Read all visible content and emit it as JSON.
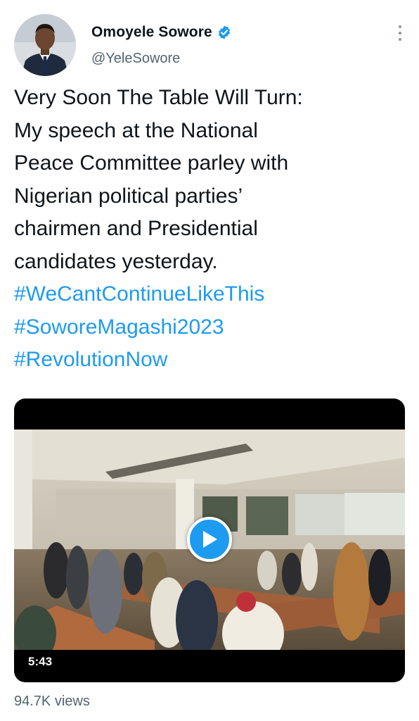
{
  "author": {
    "name": "Omoyele Sowore",
    "handle": "@YeleSowore",
    "verified": true,
    "verified_color": "#1d9bf0"
  },
  "menu": {
    "icon": "more-vertical-icon"
  },
  "tweet": {
    "lines": [
      "Very Soon The Table Will Turn:",
      "My speech at the National",
      "Peace Committee parley with",
      "Nigerian political parties’",
      "chairmen and Presidential",
      "candidates yesterday."
    ],
    "hashtags": [
      "#WeCantContinueLikeThis",
      "#SoworeMagashi2023",
      "#RevolutionNow"
    ],
    "hashtag_color": "#1d9bf0"
  },
  "media": {
    "type": "video",
    "duration": "5:43",
    "play_icon": "play-icon"
  },
  "stats": {
    "views": "94.7K views"
  }
}
